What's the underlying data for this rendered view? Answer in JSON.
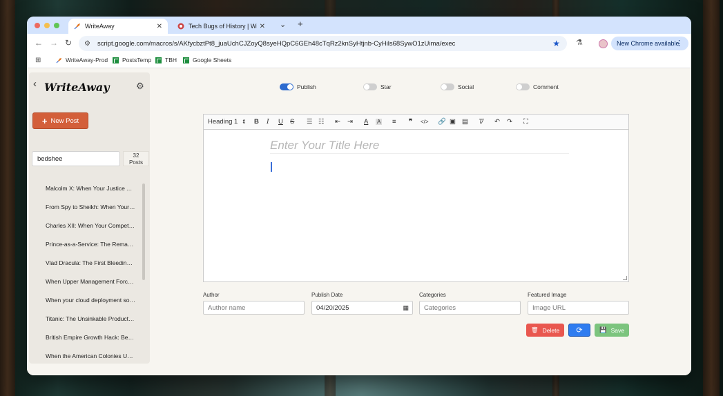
{
  "browser": {
    "tabs": [
      {
        "title": "WriteAway",
        "active": true,
        "close": "✕"
      },
      {
        "title": "Tech Bugs of History | WriteAw…",
        "active": false,
        "close": "✕"
      }
    ],
    "tab_dropdown": "⌄",
    "new_tab": "+",
    "url": "script.google.com/macros/s/AKfycbztPt8_juaUchCJZoyQ8syeHQpC6GEh48cTqRz2knSyHtjnb-CyHils68SywO1zUima/exec",
    "update_button": "New Chrome available",
    "bookmarks": [
      {
        "label": "WriteAway-Prod",
        "icon": "writeaway-favicon"
      },
      {
        "label": "PostsTemp",
        "icon": "sheets-icon"
      },
      {
        "label": "TBH",
        "icon": "sheets-icon"
      },
      {
        "label": "Google Sheets",
        "icon": "sheets-icon"
      }
    ]
  },
  "sidebar": {
    "logo": "WriteAway",
    "new_post_label": "New Post",
    "search_value": "bedshee",
    "post_count": "32",
    "post_count_label": "Posts",
    "posts": [
      "Malcolm X: When Your Justice A…",
      "From Spy to Sheikh: When Your …",
      "Charles XII: When Your Competit…",
      "Prince-as-a-Service: The Remar…",
      "Vlad Dracula: The First Bleeding …",
      "When Upper Management Force…",
      "When your cloud deployment sol…",
      "Titanic: The Unsinkable Product …",
      "British Empire Growth Hack: Bed…",
      "When the American Colonies Uni…"
    ]
  },
  "toggles": [
    {
      "label": "Publish",
      "on": true
    },
    {
      "label": "Star",
      "on": false
    },
    {
      "label": "Social",
      "on": false
    },
    {
      "label": "Comment",
      "on": false
    }
  ],
  "editor": {
    "heading_select": "Heading 1",
    "title_placeholder": "Enter Your Title Here"
  },
  "fields": {
    "author_label": "Author",
    "author_placeholder": "Author name",
    "date_label": "Publish Date",
    "date_value": "04/20/2025",
    "categories_label": "Categories",
    "categories_placeholder": "Categories",
    "image_label": "Featured Image",
    "image_placeholder": "Image URL"
  },
  "buttons": {
    "delete": "Delete",
    "save": "Save"
  },
  "colors": {
    "accent": "#d35f3a",
    "primary": "#2f7cf0",
    "danger": "#e9574f",
    "success": "#7cc47e"
  }
}
